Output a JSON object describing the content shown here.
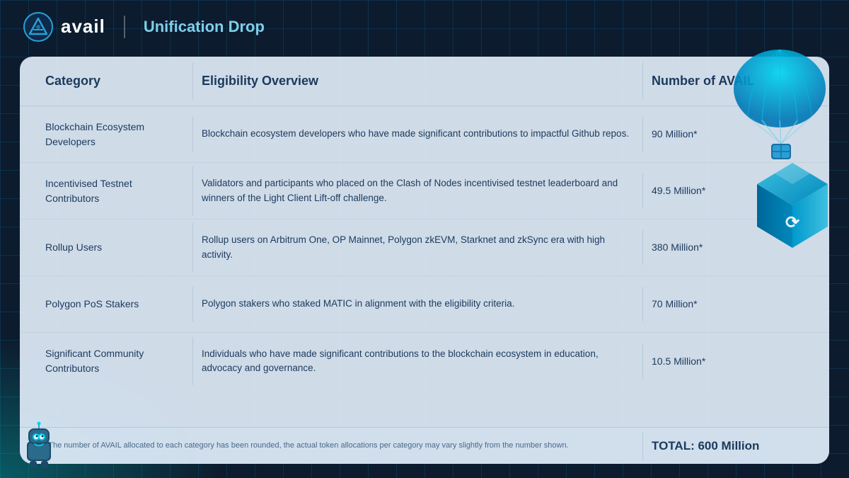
{
  "header": {
    "logo_text": "avail",
    "subtitle": "Unification Drop"
  },
  "table": {
    "columns": [
      {
        "label": "Category"
      },
      {
        "label": "Eligibility Overview"
      },
      {
        "label": "Number of AVAIL"
      }
    ],
    "rows": [
      {
        "category": "Blockchain Ecosystem Developers",
        "eligibility": "Blockchain ecosystem developers who have made significant contributions to impactful Github repos.",
        "amount": "90 Million*"
      },
      {
        "category": "Incentivised Testnet Contributors",
        "eligibility": "Validators and participants who placed on the Clash of Nodes incentivised testnet leaderboard and winners of the Light Client Lift-off challenge.",
        "amount": "49.5 Million*"
      },
      {
        "category": "Rollup Users",
        "eligibility": "Rollup users on Arbitrum One, OP Mainnet, Polygon zkEVM, Starknet and zkSync era with high activity.",
        "amount": "380 Million*"
      },
      {
        "category": "Polygon PoS Stakers",
        "eligibility": "Polygon stakers who staked MATIC in alignment with the eligibility criteria.",
        "amount": "70 Million*"
      },
      {
        "category": "Significant Community Contributors",
        "eligibility": "Individuals who have made significant contributions to the blockchain ecosystem in education, advocacy and governance.",
        "amount": "10.5 Million*"
      }
    ],
    "footer": {
      "note": "*The number of AVAIL allocated to each category has been rounded, the actual token allocations per category may vary slightly from the number shown.",
      "total": "TOTAL: 600 Million"
    }
  }
}
